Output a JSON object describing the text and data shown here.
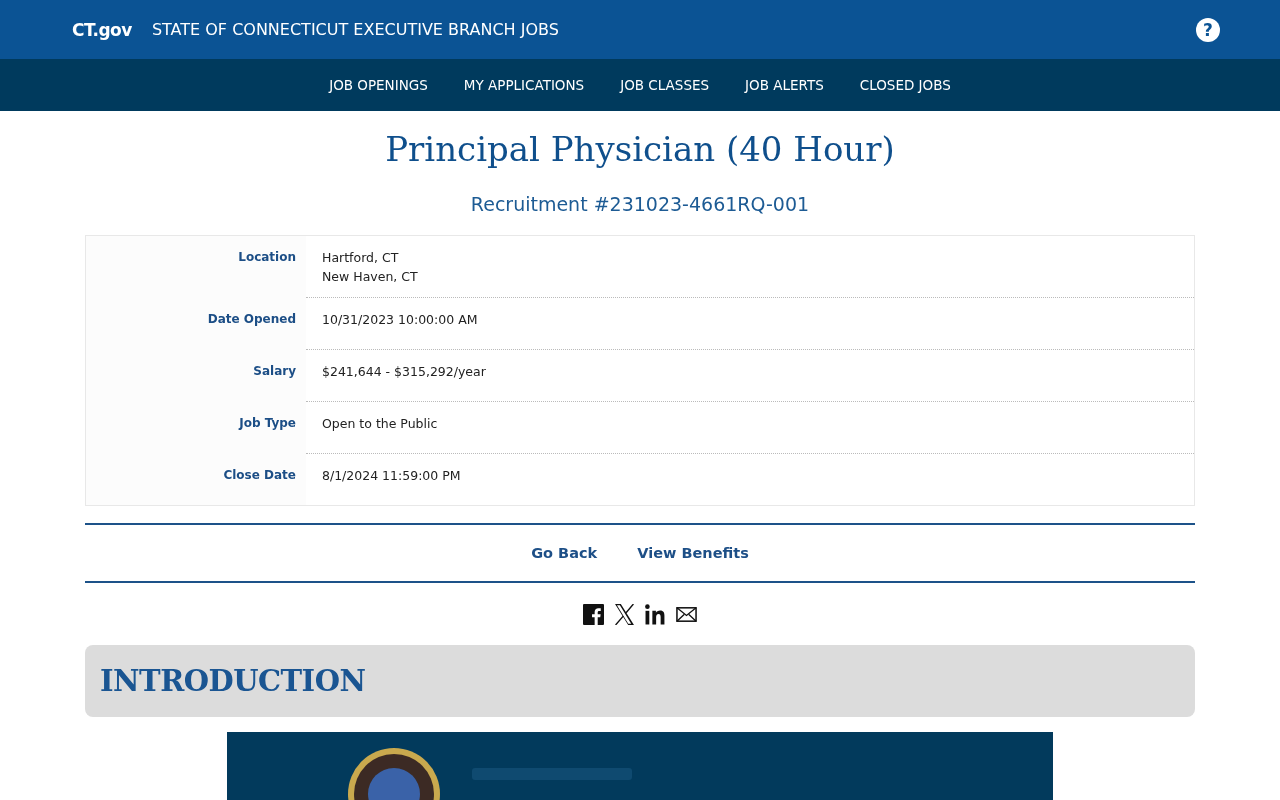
{
  "header": {
    "logo": "CT.gov",
    "title": "STATE OF CONNECTICUT EXECUTIVE BRANCH JOBS",
    "help_icon": "?"
  },
  "nav": {
    "items": [
      {
        "label": "JOB OPENINGS"
      },
      {
        "label": "MY APPLICATIONS"
      },
      {
        "label": "JOB CLASSES"
      },
      {
        "label": "JOB ALERTS"
      },
      {
        "label": "CLOSED JOBS"
      }
    ]
  },
  "job": {
    "title": "Principal Physician (40 Hour)",
    "recruitment": "Recruitment #231023-4661RQ-001",
    "details": [
      {
        "label": "Location",
        "values": [
          "Hartford, CT",
          "New Haven, CT"
        ]
      },
      {
        "label": "Date Opened",
        "values": [
          "10/31/2023 10:00:00 AM"
        ]
      },
      {
        "label": "Salary",
        "values": [
          "$241,644 - $315,292/year"
        ]
      },
      {
        "label": "Job Type",
        "values": [
          "Open to the Public"
        ]
      },
      {
        "label": "Close Date",
        "values": [
          "8/1/2024 11:59:00 PM"
        ]
      }
    ]
  },
  "actions": [
    "Go Back",
    "View Benefits"
  ],
  "share": [
    {
      "kind": "facebook"
    },
    {
      "kind": "x"
    },
    {
      "kind": "linkedin"
    },
    {
      "kind": "email"
    }
  ],
  "introduction": {
    "heading": "INTRODUCTION"
  }
}
